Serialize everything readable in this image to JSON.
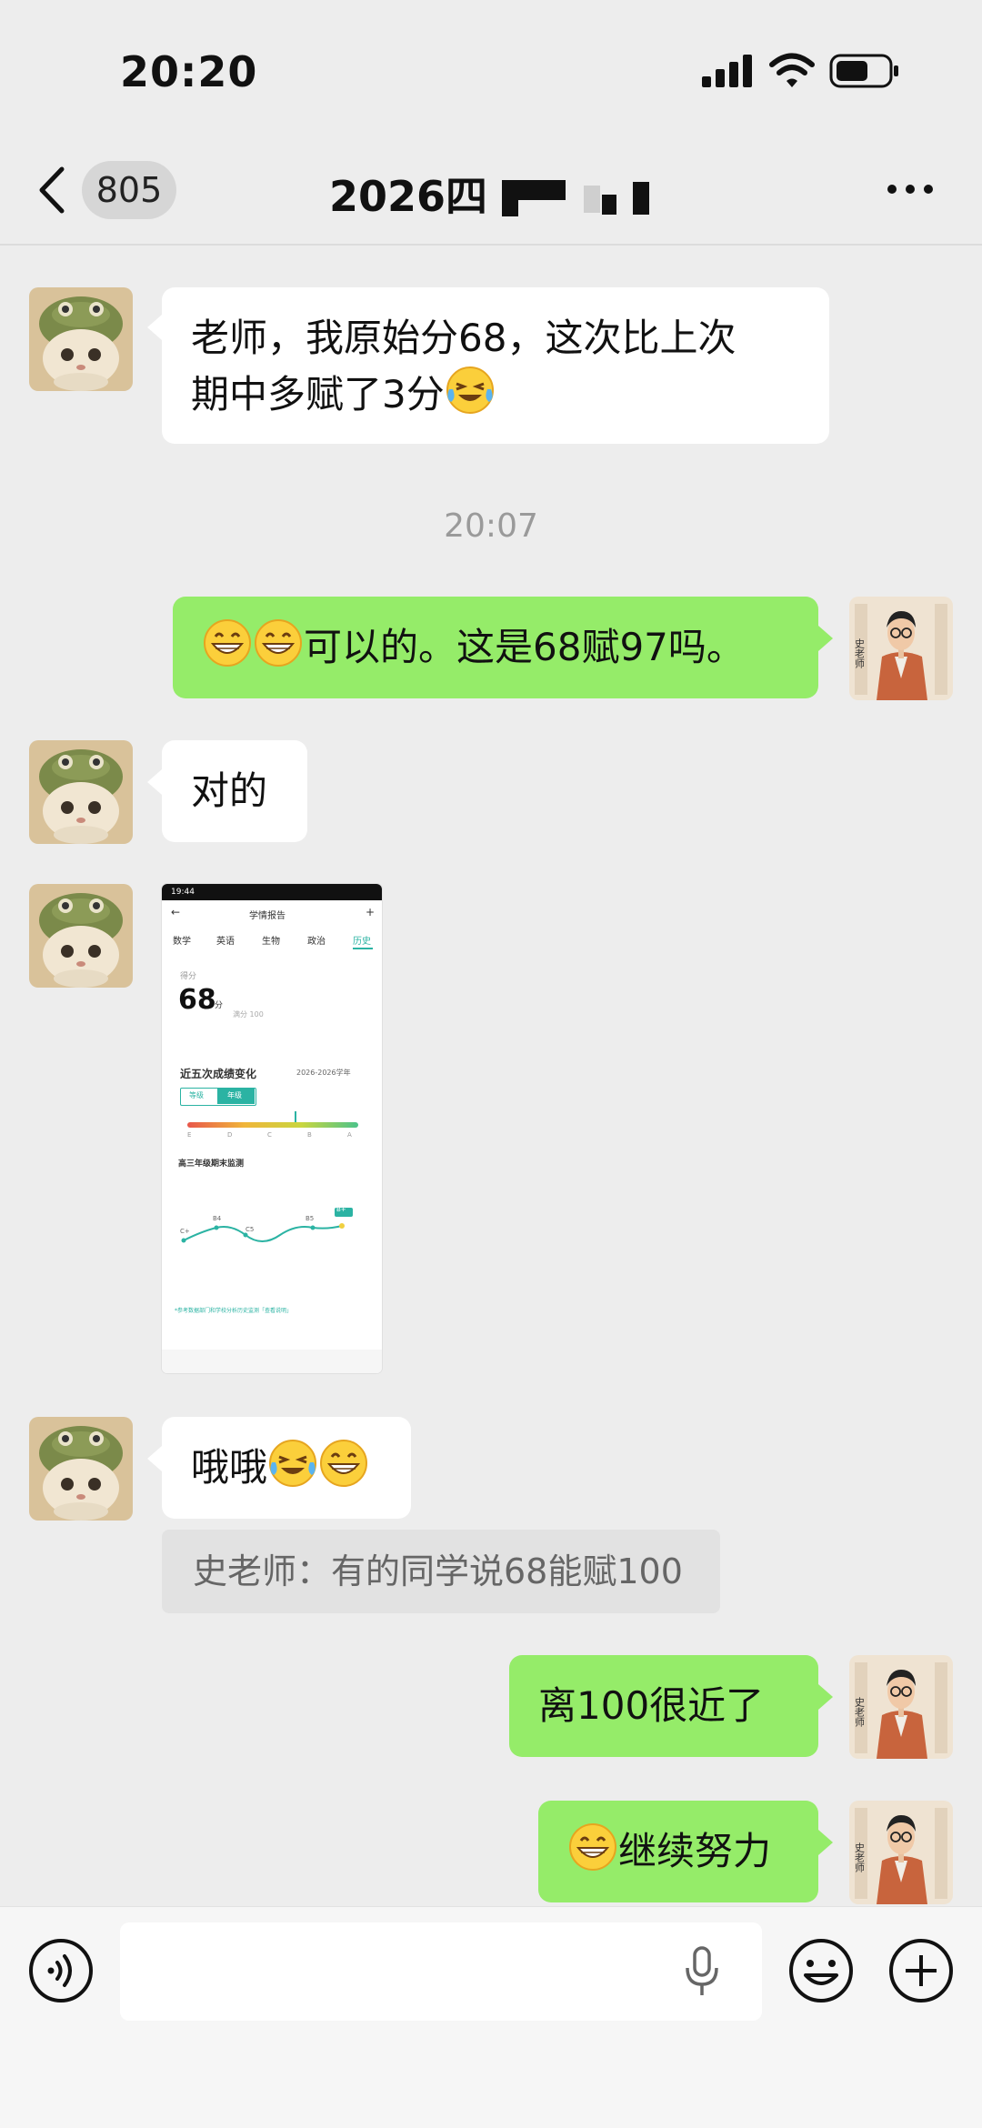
{
  "status_bar": {
    "time": "20:20"
  },
  "nav": {
    "back_badge": "805",
    "title_prefix": "2026四"
  },
  "messages": {
    "m1": {
      "text_line1": "老师，我原始分68，这次比上次",
      "text_line2": "期中多赋了3分"
    },
    "time_divider": "20:07",
    "m2": {
      "text": "可以的。这是68赋97吗。"
    },
    "m3": {
      "text": "对的"
    },
    "m5": {
      "text": "哦哦"
    },
    "quote": "史老师：有的同学说68能赋100",
    "m6": {
      "text": "离100很近了"
    },
    "m7": {
      "text": "继续努力"
    }
  },
  "shared_screenshot": {
    "status_time": "19:44",
    "header_title": "学情报告",
    "tabs": [
      "数学",
      "英语",
      "生物",
      "政治",
      "历史"
    ],
    "score_label": "得分",
    "score_value": "68",
    "score_unit": "分",
    "score_total": "满分 100",
    "trend_title": "近五次成绩变化",
    "year_range": "2026-2026学年",
    "toggle": [
      "等级",
      "年级"
    ],
    "grade_scale": [
      "E",
      "D",
      "C",
      "B",
      "A"
    ],
    "exam_title": "高三年级期末监测",
    "chart_point_labels": [
      "C+",
      "B4",
      "C5",
      "B5",
      "B+"
    ],
    "footnote": "*参考数据部门和学校分析历史监测「查看说明」"
  },
  "icons": {
    "back": "chevron-left-icon",
    "more": "more-dots-icon",
    "voice": "voice-wave-icon",
    "mic": "microphone-icon",
    "emoji": "smiley-icon",
    "plus": "plus-icon",
    "grin_emoji": "grinning-emoji",
    "laugh_cry_emoji": "laugh-cry-emoji"
  },
  "colors": {
    "outgoing_bubble": "#95ec69",
    "incoming_bubble": "#ffffff",
    "background": "#ededed"
  }
}
